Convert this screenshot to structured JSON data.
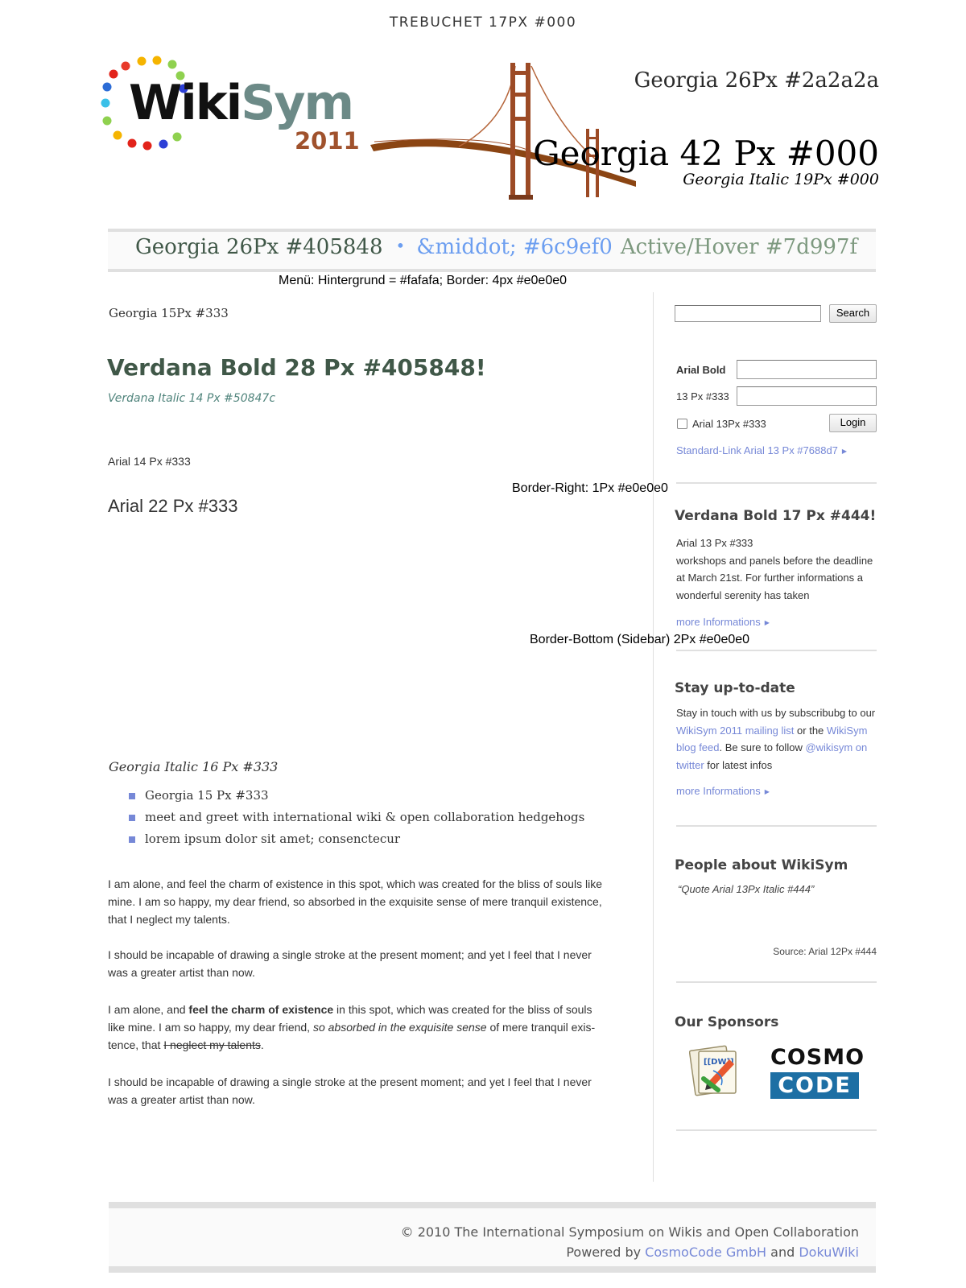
{
  "top_note": "TREBUCHET 17PX #000",
  "logo": {
    "wiki": "Wiki",
    "sym": "Sym",
    "year": "2011"
  },
  "header": {
    "small": "Georgia 26Px #2a2a2a",
    "big": "Georgia 42 Px #000",
    "italic": "Georgia Italic 19Px #000"
  },
  "menu": {
    "item_1": "Georgia 26Px #405848",
    "dot": "•",
    "item_2": "&middot; #6c9ef0",
    "item_3": "Active/Hover #7d997f",
    "note": "Menü: Hintergrund = #fafafa; Border: 4px #e0e0e0",
    "colors": {
      "background": "#fafafa",
      "border": "#e0e0e0",
      "text": "#405848",
      "dot": "#6c9ef0",
      "active": "#7d997f"
    }
  },
  "main": {
    "breadcrumb": "Georgia 15Px #333",
    "title": "Verdana Bold 28 Px #405848!",
    "subtitle": "Verdana Italic 14 Px #50847c",
    "arial14": "Arial 14 Px #333",
    "arial22": "Arial 22 Px #333",
    "border_right_note": "Border-Right: 1Px #e0e0e0",
    "border_bottom_note": "Border-Bottom (Sidebar) 2Px #e0e0e0",
    "georgia_italic": "Georgia Italic 16 Px #333",
    "list": [
      "Georgia 15 Px #333",
      "meet and greet with international wiki & open collaboration hedgehogs",
      "lorem ipsum dolor sit amet; consenctecur"
    ],
    "para_1": "I am alone, and feel the charm of existence in this spot, which was created for the bliss of souls like mine. I am so happy, my dear friend, so absorbed in the exquisite sense of mere tranquil existence, that I neglect my talents.",
    "para_2": "I should be incapable of drawing a single stroke at the present moment; and yet I feel that I never was a greater artist than now.",
    "para_3": {
      "a": "I am alone, and ",
      "b": "feel the charm of existence",
      "c": " in this spot, which was created for the bliss of souls like mine. I am so happy, my dear friend, ",
      "d": "so absorbed in the exquisite sense",
      "e": " of mere tranquil exis-tence, that ",
      "f": "I neglect my talents",
      "g": "."
    },
    "para_4": "I should be incapable of drawing a single stroke at the present moment; and yet I feel that I never was a greater artist than now."
  },
  "sidebar": {
    "search_value": "",
    "search_button": "Search",
    "label_user": "Arial Bold",
    "label_pass": "13 Px #333",
    "user_value": "",
    "pass_value": "",
    "remember": "Arial 13Px #333",
    "login_button": "Login",
    "standard_link": "Standard-Link Arial 13 Px #7688d7",
    "section_1": {
      "heading": "Verdana Bold 17 Px #444!",
      "line_1": "Arial 13 Px #333",
      "text": "workshops and panels before the deadline at March 21st. For further informations a wonderful serenity has taken",
      "more": "more Informations"
    },
    "section_2": {
      "heading": "Stay up-to-date",
      "t1": "Stay in touch with us by subscribubg to our ",
      "l1": "WikiSym 2011 mailing list",
      "t2": " or the ",
      "l2": "WikiSym blog feed",
      "t3": ". Be sure to follow ",
      "l3": "@wikisym on twitter",
      "t4": " for latest infos",
      "more": "more Informations"
    },
    "section_3": {
      "heading": "People about WikiSym",
      "quote": "“Quote Arial 13Px Italic #444”",
      "source": "Source: Arial 12Px #444"
    },
    "section_4": {
      "heading": "Our Sponsors",
      "cosmo_top": "COSMO",
      "cosmo_bottom": "CODE",
      "dokuwiki_label": "[[DW]]"
    },
    "colors": {
      "link": "#7688d7",
      "border": "#e0e0e0",
      "cosmo_blue": "#1d6fa4"
    }
  },
  "footer": {
    "line_1": "© 2010 The International Symposium on Wikis and Open Collaboration",
    "powered": "Powered by ",
    "link_1": "CosmoCode GmbH",
    "and": " and ",
    "link_2": "DokuWiki"
  }
}
